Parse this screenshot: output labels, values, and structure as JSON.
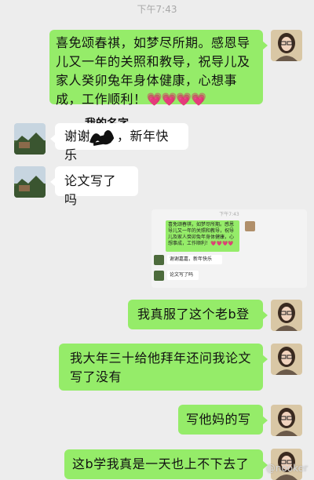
{
  "status": {
    "time": "下午7:43"
  },
  "annotation": {
    "label": "我的名字"
  },
  "messages": [
    {
      "side": "out",
      "text": "喜免颂春祺，如梦尽所期。感恩导儿又一年的关照和教导，祝导儿及家人癸卯兔年身体健康，心想事成，工作顺利！",
      "emoji": "💗💗💗💗"
    },
    {
      "side": "in",
      "text_before": "谢谢",
      "text_after": "，新年快乐"
    },
    {
      "side": "in",
      "text": "论文写了吗"
    },
    {
      "side": "out",
      "text": "我真服了这个老b登"
    },
    {
      "side": "out",
      "text": "我大年三十给他拜年还问我论文写了没有"
    },
    {
      "side": "out",
      "text": "写他妈的写"
    },
    {
      "side": "out",
      "text": "这b学我真是一天也上不下去了"
    }
  ],
  "embedded": {
    "time": "下午7:43",
    "msg1": "喜免颂春祺，如梦尽所期。感恩导儿又一年的关照和教导，祝导儿及家人癸卯兔年身体健康，心想事成，工作顺利！💗💗💗💗",
    "msg2": "谢谢嘉嘉，新年快乐",
    "msg3": "论文写了吗"
  },
  "watermark": "@nooker",
  "colors": {
    "outgoing": "#95ec69",
    "incoming": "#ffffff",
    "background": "#ededed"
  }
}
